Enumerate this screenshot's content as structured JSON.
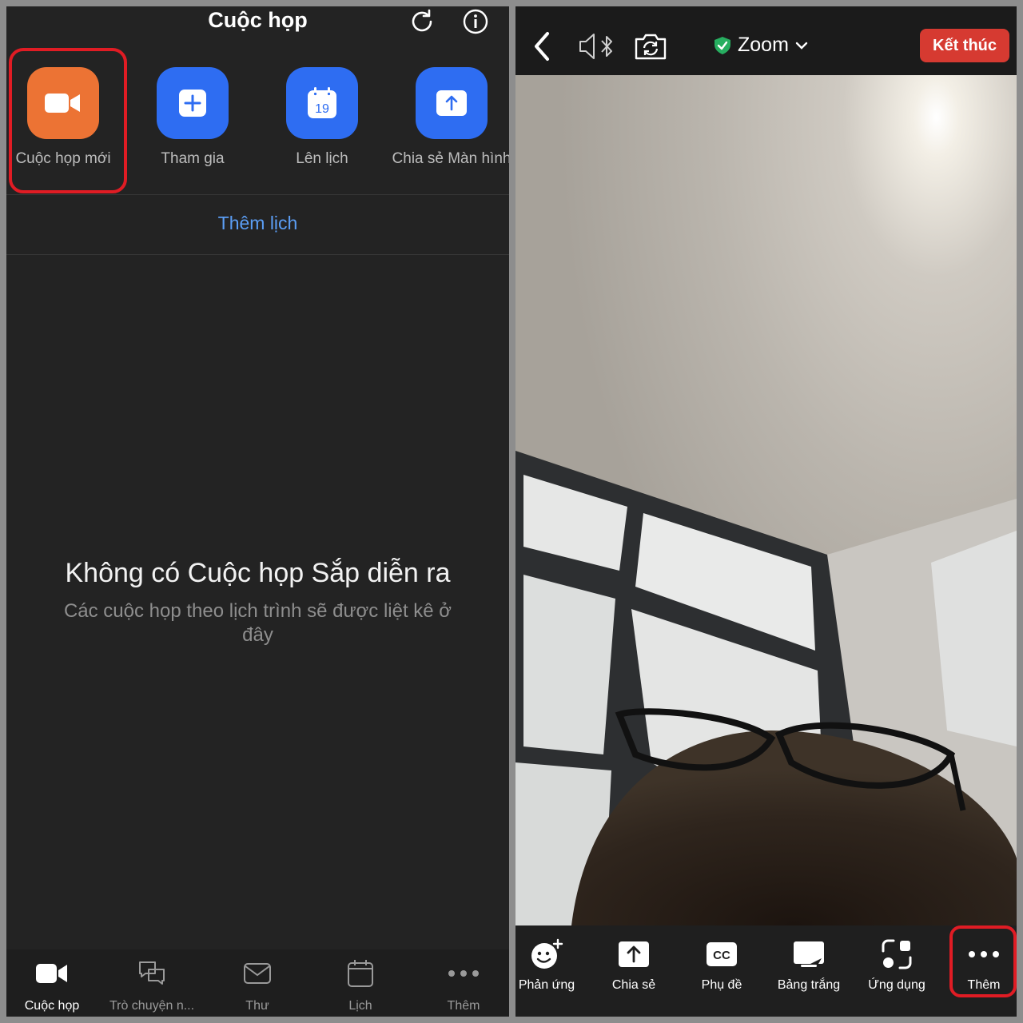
{
  "left": {
    "header": {
      "title": "Cuộc họp"
    },
    "actions": [
      {
        "label": "Cuộc họp mới",
        "color": "#ec7334"
      },
      {
        "label": "Tham gia",
        "color": "#2e6df2"
      },
      {
        "label": "Lên lịch",
        "color": "#2e6df2",
        "calendar_day": "19"
      },
      {
        "label": "Chia sẻ Màn hình",
        "color": "#2e6df2"
      }
    ],
    "add_calendar": "Thêm lịch",
    "empty_state": {
      "title": "Không có Cuộc họp Sắp diễn ra",
      "subtitle": "Các cuộc họp theo lịch trình sẽ được liệt kê ở đây"
    },
    "tabs": [
      {
        "label": "Cuộc họp",
        "icon": "video-camera-icon",
        "active": true
      },
      {
        "label": "Trò chuyện n...",
        "icon": "chat-bubbles-icon",
        "active": false
      },
      {
        "label": "Thư",
        "icon": "mail-icon",
        "active": false
      },
      {
        "label": "Lịch",
        "icon": "calendar-icon",
        "active": false
      },
      {
        "label": "Thêm",
        "icon": "more-dots-icon",
        "active": false
      }
    ],
    "highlight_color": "#e01c24"
  },
  "right": {
    "top_bar": {
      "title": "Zoom",
      "end_label": "Kết thúc",
      "end_color": "#d63a31",
      "shield_color": "#27ae60"
    },
    "toolbar": [
      {
        "label": "Phản ứng",
        "icon": "reaction-icon"
      },
      {
        "label": "Chia sẻ",
        "icon": "share-icon"
      },
      {
        "label": "Phụ đề",
        "icon": "captions-icon",
        "icon_text": "CC"
      },
      {
        "label": "Bảng trắng",
        "icon": "whiteboard-icon"
      },
      {
        "label": "Ứng dụng",
        "icon": "apps-icon"
      },
      {
        "label": "Thêm",
        "icon": "more-dots-icon"
      }
    ]
  }
}
